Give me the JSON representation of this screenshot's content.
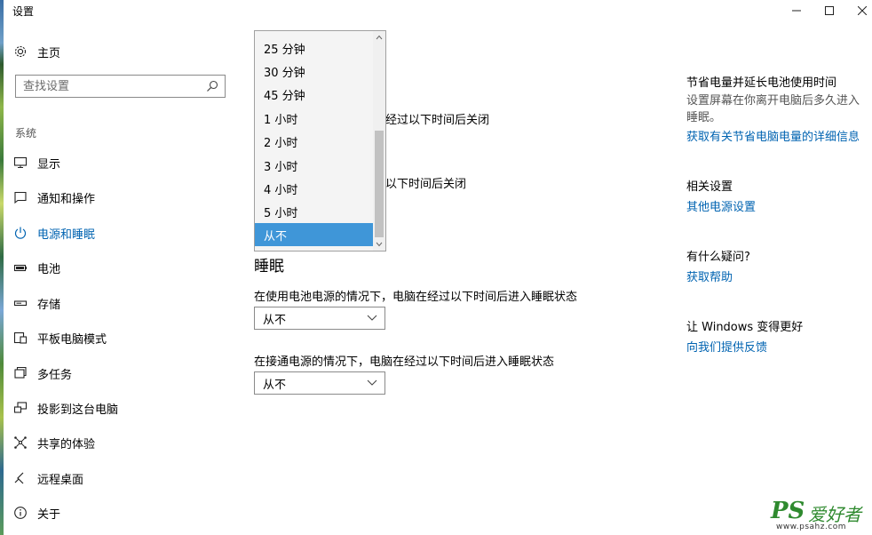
{
  "window": {
    "title": "设置",
    "min": "—",
    "max": "☐",
    "close": "✕"
  },
  "sidebar": {
    "home": "主页",
    "search_placeholder": "查找设置",
    "section": "系统",
    "items": [
      {
        "label": "显示",
        "icon": "monitor-icon"
      },
      {
        "label": "通知和操作",
        "icon": "notification-icon"
      },
      {
        "label": "电源和睡眠",
        "icon": "power-icon",
        "active": true
      },
      {
        "label": "电池",
        "icon": "battery-icon"
      },
      {
        "label": "存储",
        "icon": "storage-icon"
      },
      {
        "label": "平板电脑模式",
        "icon": "tablet-icon"
      },
      {
        "label": "多任务",
        "icon": "multitask-icon"
      },
      {
        "label": "投影到这台电脑",
        "icon": "project-icon"
      },
      {
        "label": "共享的体验",
        "icon": "share-icon"
      },
      {
        "label": "远程桌面",
        "icon": "remote-icon"
      },
      {
        "label": "关于",
        "icon": "info-icon"
      }
    ]
  },
  "main": {
    "screen_battery_partial": "经过以下时间后关闭",
    "screen_plugged_partial": "以下时间后关闭",
    "sleep_heading": "睡眠",
    "sleep_battery_label": "在使用电池电源的情况下，电脑在经过以下时间后进入睡眠状态",
    "sleep_battery_value": "从不",
    "sleep_plugged_label": "在接通电源的情况下，电脑在经过以下时间后进入睡眠状态",
    "sleep_plugged_value": "从不",
    "dropdown_options": [
      "25 分钟",
      "30 分钟",
      "45 分钟",
      "1 小时",
      "2 小时",
      "3 小时",
      "4 小时",
      "5 小时",
      "从不"
    ],
    "dropdown_selected": "从不"
  },
  "right_panel": {
    "tip_title": "节省电量并延长电池使用时间",
    "tip_desc": "设置屏幕在你离开电脑后多久进入睡眠。",
    "tip_link": "获取有关节省电脑电量的详细信息",
    "related_title": "相关设置",
    "related_link": "其他电源设置",
    "question_title": "有什么疑问?",
    "question_link": "获取帮助",
    "improve_title": "让 Windows 变得更好",
    "improve_link": "向我们提供反馈"
  },
  "watermark": {
    "ps": "PS",
    "cn": "爱好者",
    "url": "www.psahz.com"
  },
  "colors": {
    "accent": "#0063b1",
    "selected": "#3f96d8"
  }
}
